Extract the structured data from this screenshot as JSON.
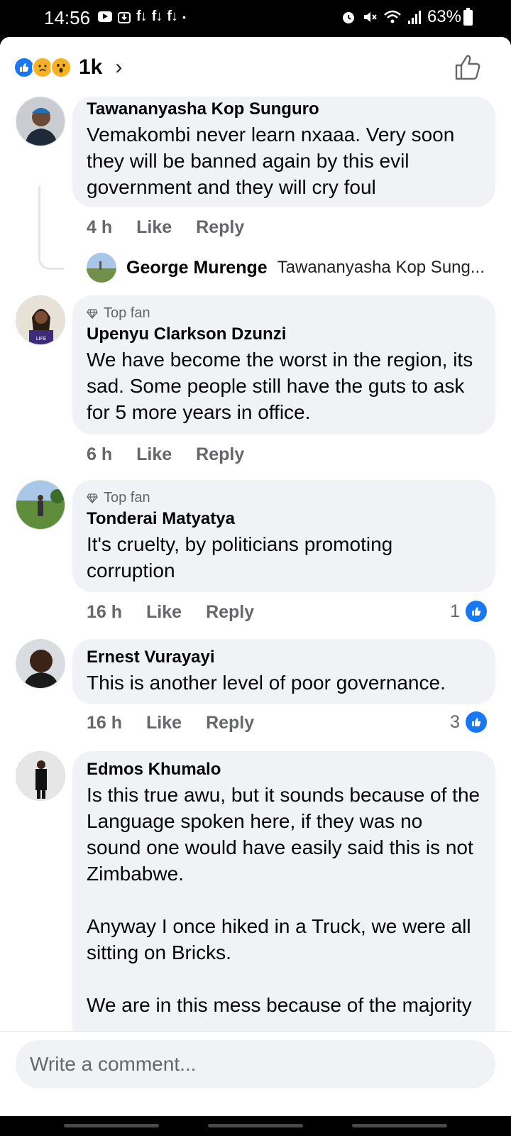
{
  "status_bar": {
    "time": "14:56",
    "notif_fb_1": "f↓",
    "notif_fb_2": "f↓",
    "notif_fb_3": "f↓",
    "dot": "•",
    "battery": "63%"
  },
  "header": {
    "reaction_count": "1k",
    "reaction_icons": [
      "like-icon",
      "sad-icon",
      "wow-icon"
    ],
    "chevron": "›"
  },
  "comments": [
    {
      "author": "Tawananyasha Kop Sunguro",
      "text": "Vemakombi never learn nxaaa. Very soon they will be banned again by this evil government and they will cry foul",
      "time": "4 h",
      "like": "Like",
      "reply": "Reply"
    },
    {
      "badge": "Top fan",
      "author": "Upenyu Clarkson Dzunzi",
      "text": "We have become the worst in the region, its sad. Some people still have the guts to ask for 5 more years in office.",
      "time": "6 h",
      "like": "Like",
      "reply": "Reply"
    },
    {
      "badge": "Top fan",
      "author": "Tonderai Matyatya",
      "text": "It's cruelty, by politicians promoting corruption",
      "time": "16 h",
      "like": "Like",
      "reply": "Reply",
      "likes": "1"
    },
    {
      "author": "Ernest Vurayayi",
      "text": "This is another level of poor governance.",
      "time": "16 h",
      "like": "Like",
      "reply": "Reply",
      "likes": "3"
    },
    {
      "author": "Edmos Khumalo",
      "text": "Is this true awu, but it sounds because of the Language spoken here, if they was no sound one would have easily said this is not Zimbabwe.\n\nAnyway I once hiked in a Truck, we were all sitting on Bricks.\n\nWe are in this mess because of the majority"
    }
  ],
  "reply_preview": {
    "author": "George Murenge",
    "snippet": "Tawananyasha Kop Sung..."
  },
  "composer": {
    "placeholder": "Write a comment..."
  },
  "colors": {
    "accent": "#1877f2",
    "bubble": "#f0f2f5",
    "meta": "#65676b"
  }
}
